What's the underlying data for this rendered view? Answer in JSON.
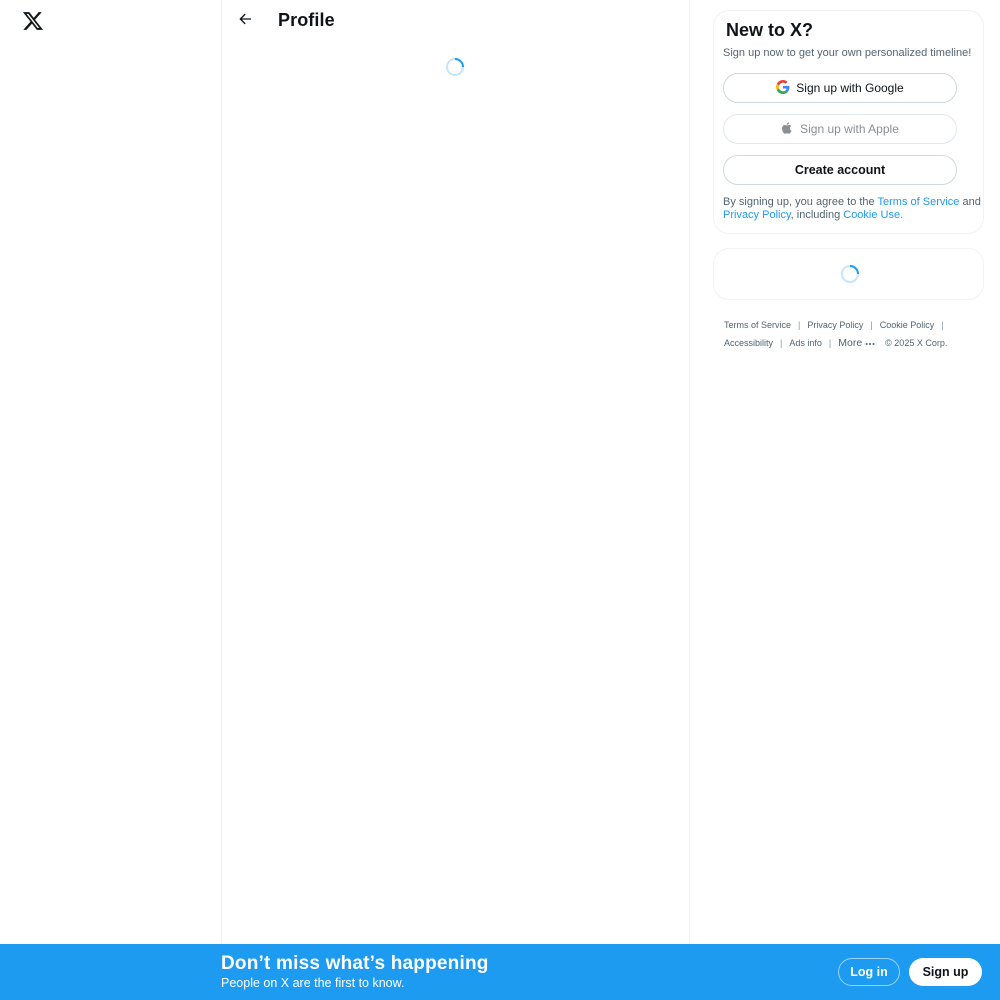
{
  "header": {
    "title": "Profile"
  },
  "icons": {
    "logo": "x-logo-icon",
    "back": "arrow-left-icon",
    "loading": "spinner-icon",
    "google": "google-icon",
    "apple": "apple-icon",
    "more": "ellipsis-icon"
  },
  "signup_card": {
    "title": "New to X?",
    "subtitle": "Sign up now to get your own personalized timeline!",
    "google_label": "Sign up with Google",
    "apple_label": "Sign up with Apple",
    "create_label": "Create account",
    "legal_prefix": "By signing up, you agree to the ",
    "legal_terms": "Terms of Service",
    "legal_and": " and ",
    "legal_privacy": "Privacy Policy",
    "legal_including": ", including ",
    "legal_cookie": "Cookie Use",
    "legal_end": "."
  },
  "footer": {
    "terms": "Terms of Service",
    "privacy": "Privacy Policy",
    "cookie": "Cookie Policy",
    "accessibility": "Accessibility",
    "ads": "Ads info",
    "more": "More",
    "copyright": "© 2025 X Corp.",
    "separator": "|"
  },
  "bottom_bar": {
    "title": "Don’t miss what’s happening",
    "subtitle": "People on X are the first to know.",
    "login_label": "Log in",
    "signup_label": "Sign up"
  },
  "colors": {
    "accent": "#1d9bf0",
    "text": "#0f1419",
    "muted": "#536471",
    "border": "#eff3f4"
  }
}
